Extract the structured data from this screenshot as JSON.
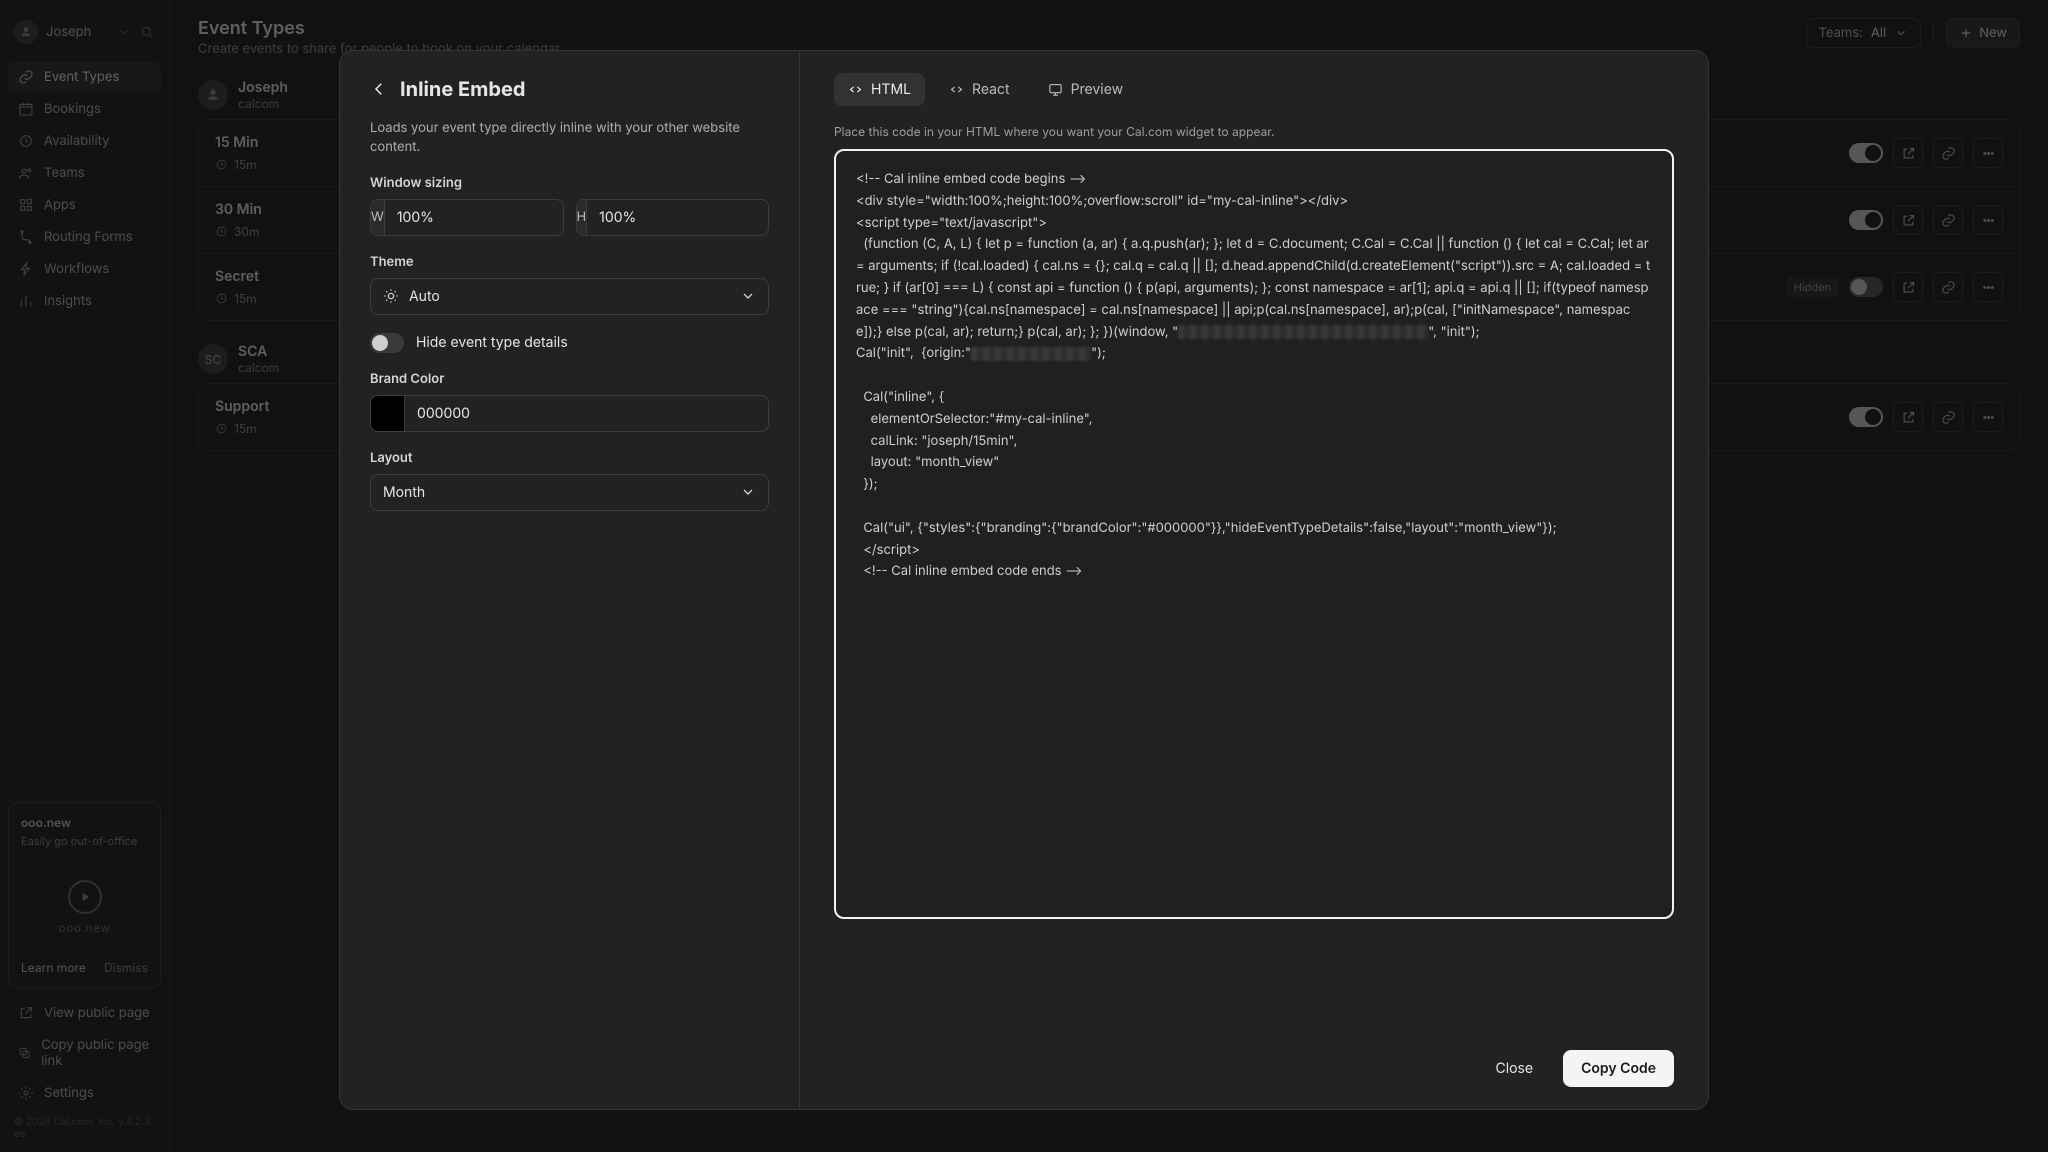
{
  "user": {
    "name": "Joseph"
  },
  "sidebar": {
    "items": [
      {
        "label": "Event Types"
      },
      {
        "label": "Bookings"
      },
      {
        "label": "Availability"
      },
      {
        "label": "Teams"
      },
      {
        "label": "Apps"
      },
      {
        "label": "Routing Forms"
      },
      {
        "label": "Workflows"
      },
      {
        "label": "Insights"
      }
    ],
    "promo": {
      "title": "ooo.new",
      "sub": "Easily go out-of-office",
      "brand": "ooo.new",
      "learn": "Learn more",
      "dismiss": "Dismiss"
    },
    "bottom": {
      "view": "View public page",
      "copy": "Copy public page link",
      "settings": "Settings"
    },
    "copyright": "© 2024 Cal.com, Inc. v.4.2.3-ee"
  },
  "page": {
    "title": "Event Types",
    "subtitle": "Create events to share for people to book on your calendar.",
    "teams_label": "Teams:",
    "teams_value": "All",
    "new": "New"
  },
  "groups": [
    {
      "name": "Joseph",
      "slug": "calcom",
      "events": [
        {
          "title": "15 Min",
          "dur": "15m",
          "on": true
        },
        {
          "title": "30 Min",
          "dur": "30m",
          "on": true
        },
        {
          "title": "Secret",
          "dur": "15m",
          "hidden": "Hidden",
          "on": false
        }
      ]
    },
    {
      "name": "SCA",
      "sc": "SC",
      "slug": "calcom",
      "events": [
        {
          "title": "Support",
          "dur": "15m",
          "on": true
        }
      ]
    }
  ],
  "modal": {
    "title": "Inline Embed",
    "desc": "Loads your event type directly inline with your other website content.",
    "window_sizing_lbl": "Window sizing",
    "w": "W",
    "w_val": "100%",
    "h": "H",
    "h_val": "100%",
    "theme_lbl": "Theme",
    "theme_val": "Auto",
    "hide_lbl": "Hide event type details",
    "brand_lbl": "Brand Color",
    "brand_val": "000000",
    "layout_lbl": "Layout",
    "layout_val": "Month",
    "tabs": {
      "html": "HTML",
      "react": "React",
      "preview": "Preview"
    },
    "hint": "Place this code in your HTML where you want your Cal.com widget to appear.",
    "close": "Close",
    "copy": "Copy Code",
    "code_part1": "<!-- Cal inline embed code begins -->\n<div style=\"width:100%;height:100%;overflow:scroll\" id=\"my-cal-inline\"></div>\n<script type=\"text/javascript\">\n  (function (C, A, L) { let p = function (a, ar) { a.q.push(ar); }; let d = C.document; C.Cal = C.Cal || function () { let cal = C.Cal; let ar = arguments; if (!cal.loaded) { cal.ns = {}; cal.q = cal.q || []; d.head.appendChild(d.createElement(\"script\")).src = A; cal.loaded = true; } if (ar[0] === L) { const api = function () { p(api, arguments); }; const namespace = ar[1]; api.q = api.q || []; if(typeof namespace === \"string\"){cal.ns[namespace] = cal.ns[namespace] || api;p(cal.ns[namespace], ar);p(cal, [\"initNamespace\", namespace]);} else p(cal, ar); return;} p(cal, ar); }; })(window, \"",
    "code_part2": "\", \"init\");\nCal(\"init\",  {origin:\"",
    "code_part3": "\");\n\n  Cal(\"inline\", {\n    elementOrSelector:\"#my-cal-inline\",\n    calLink: \"joseph/15min\",\n    layout: \"month_view\"\n  });\n\n  Cal(\"ui\", {\"styles\":{\"branding\":{\"brandColor\":\"#000000\"}},\"hideEventTypeDetails\":false,\"layout\":\"month_view\"});\n  </script>\n  <!-- Cal inline embed code ends -->"
  }
}
